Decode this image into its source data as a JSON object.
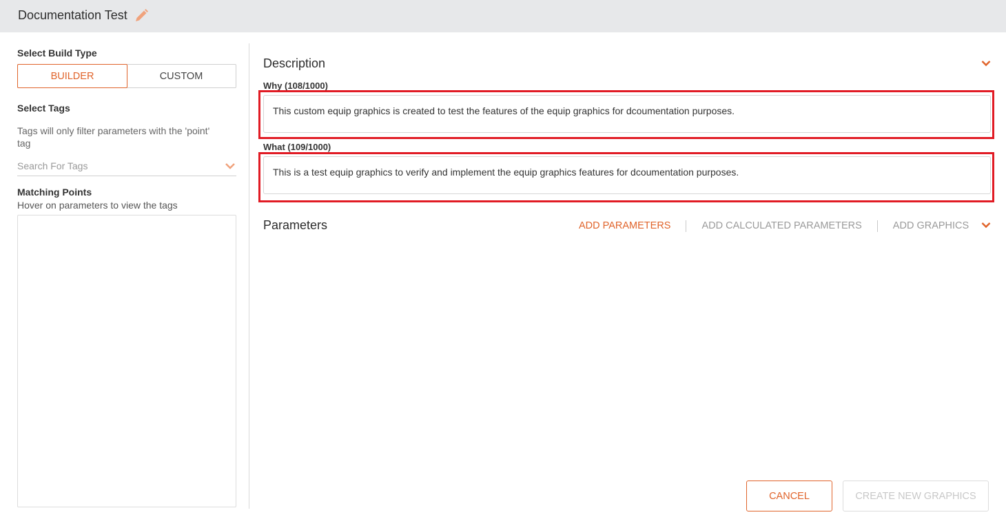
{
  "header": {
    "title": "Documentation Test",
    "edit_icon": "pencil-icon"
  },
  "left_panel": {
    "build_type_label": "Select Build Type",
    "build_options": [
      {
        "label": "BUILDER",
        "active": true
      },
      {
        "label": "CUSTOM",
        "active": false
      }
    ],
    "tags_label": "Select Tags",
    "tags_hint_line1": "Tags will only filter parameters with the 'point'",
    "tags_hint_line2": "tag",
    "tags_search_placeholder": "Search For Tags",
    "matching_points_label": "Matching Points",
    "matching_points_hint": "Hover on parameters to view the tags"
  },
  "description": {
    "title": "Description",
    "why_label": "Why (108/1000)",
    "why_value": "This custom equip graphics is created to test the features of the equip graphics for dcoumentation purposes.",
    "what_label": "What (109/1000)",
    "what_value": "This is a test equip graphics to verify and implement the equip graphics features for dcoumentation purposes."
  },
  "parameters": {
    "title": "Parameters",
    "add_parameters": "ADD PARAMETERS",
    "add_calculated_parameters": "ADD CALCULATED PARAMETERS",
    "add_graphics": "ADD GRAPHICS"
  },
  "footer": {
    "cancel_label": "CANCEL",
    "create_label": "CREATE NEW GRAPHICS"
  },
  "colors": {
    "accent": "#e0632a",
    "highlight": "#e11b24",
    "header_bg": "#e7e8ea"
  }
}
